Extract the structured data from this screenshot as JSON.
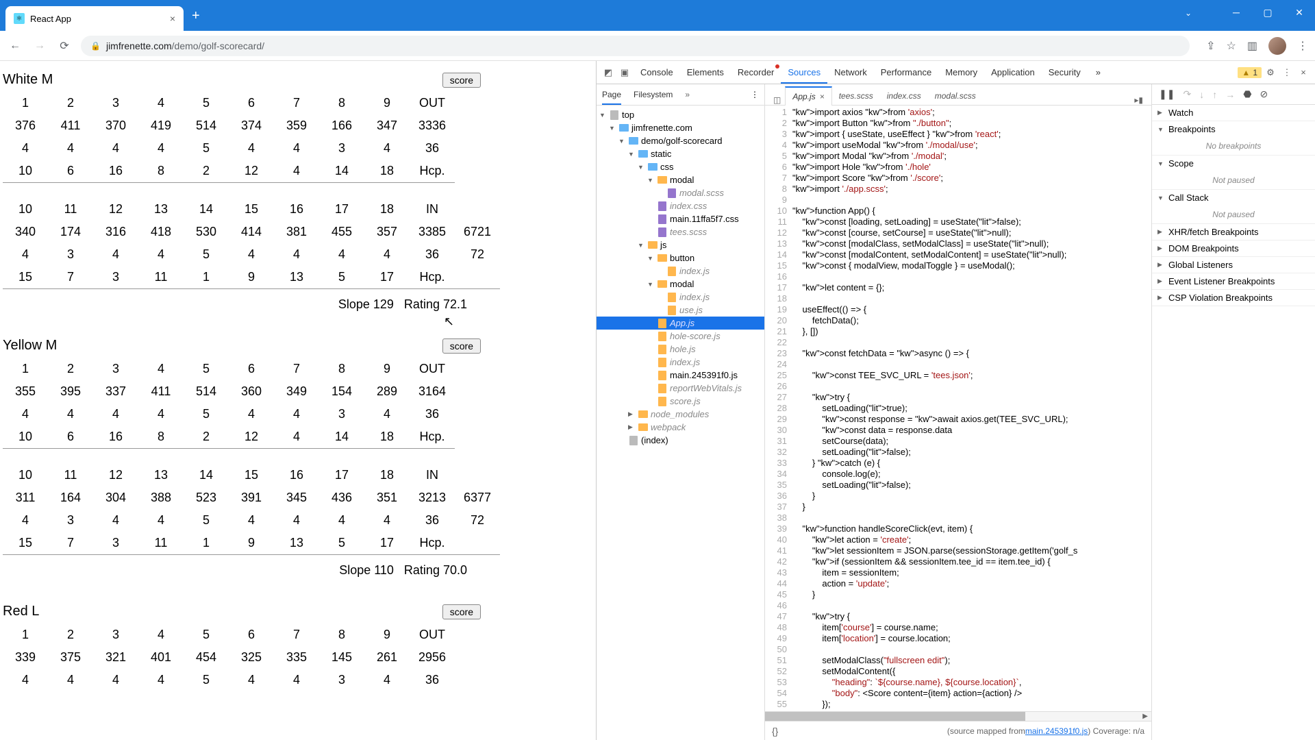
{
  "browser": {
    "tab_title": "React App",
    "url_host": "jimfrenette.com",
    "url_path": "/demo/golf-scorecard/"
  },
  "tees": [
    {
      "name": "White M",
      "score_btn": "score",
      "holes_out": [
        "1",
        "2",
        "3",
        "4",
        "5",
        "6",
        "7",
        "8",
        "9",
        "OUT"
      ],
      "yards_out": [
        "376",
        "411",
        "370",
        "419",
        "514",
        "374",
        "359",
        "166",
        "347",
        "3336"
      ],
      "par_out": [
        "4",
        "4",
        "4",
        "4",
        "5",
        "4",
        "4",
        "3",
        "4",
        "36"
      ],
      "hcp_out": [
        "10",
        "6",
        "16",
        "8",
        "2",
        "12",
        "4",
        "14",
        "18",
        "Hcp."
      ],
      "holes_in": [
        "10",
        "11",
        "12",
        "13",
        "14",
        "15",
        "16",
        "17",
        "18",
        "IN",
        ""
      ],
      "yards_in": [
        "340",
        "174",
        "316",
        "418",
        "530",
        "414",
        "381",
        "455",
        "357",
        "3385",
        "6721"
      ],
      "par_in": [
        "4",
        "3",
        "4",
        "4",
        "5",
        "4",
        "4",
        "4",
        "4",
        "36",
        "72"
      ],
      "hcp_in": [
        "15",
        "7",
        "3",
        "11",
        "1",
        "9",
        "13",
        "5",
        "17",
        "Hcp.",
        ""
      ],
      "slope": "Slope 129",
      "rating": "Rating 72.1"
    },
    {
      "name": "Yellow M",
      "score_btn": "score",
      "holes_out": [
        "1",
        "2",
        "3",
        "4",
        "5",
        "6",
        "7",
        "8",
        "9",
        "OUT"
      ],
      "yards_out": [
        "355",
        "395",
        "337",
        "411",
        "514",
        "360",
        "349",
        "154",
        "289",
        "3164"
      ],
      "par_out": [
        "4",
        "4",
        "4",
        "4",
        "5",
        "4",
        "4",
        "3",
        "4",
        "36"
      ],
      "hcp_out": [
        "10",
        "6",
        "16",
        "8",
        "2",
        "12",
        "4",
        "14",
        "18",
        "Hcp."
      ],
      "holes_in": [
        "10",
        "11",
        "12",
        "13",
        "14",
        "15",
        "16",
        "17",
        "18",
        "IN",
        ""
      ],
      "yards_in": [
        "311",
        "164",
        "304",
        "388",
        "523",
        "391",
        "345",
        "436",
        "351",
        "3213",
        "6377"
      ],
      "par_in": [
        "4",
        "3",
        "4",
        "4",
        "5",
        "4",
        "4",
        "4",
        "4",
        "36",
        "72"
      ],
      "hcp_in": [
        "15",
        "7",
        "3",
        "11",
        "1",
        "9",
        "13",
        "5",
        "17",
        "Hcp.",
        ""
      ],
      "slope": "Slope 110",
      "rating": "Rating 70.0"
    },
    {
      "name": "Red L",
      "score_btn": "score",
      "holes_out": [
        "1",
        "2",
        "3",
        "4",
        "5",
        "6",
        "7",
        "8",
        "9",
        "OUT"
      ],
      "yards_out": [
        "339",
        "375",
        "321",
        "401",
        "454",
        "325",
        "335",
        "145",
        "261",
        "2956"
      ],
      "par_out": [
        "4",
        "4",
        "4",
        "4",
        "5",
        "4",
        "4",
        "3",
        "4",
        "36"
      ]
    }
  ],
  "devtools": {
    "tabs": [
      "Console",
      "Elements",
      "Recorder",
      "Sources",
      "Network",
      "Performance",
      "Memory",
      "Application",
      "Security"
    ],
    "active_tab": "Sources",
    "issue_count": "1",
    "src_subtabs": [
      "Page",
      "Filesystem"
    ],
    "editor_tabs": [
      "App.js",
      "tees.scss",
      "index.css",
      "modal.scss"
    ],
    "active_editor_tab": "App.js",
    "tree": {
      "top": "top",
      "domain": "jimfrenette.com",
      "demo": "demo/golf-scorecard",
      "static": "static",
      "css": "css",
      "modal_css": "modal",
      "modal_scss": "modal.scss",
      "index_css": "index.css",
      "main_css": "main.11ffa5f7.css",
      "tees_scss": "tees.scss",
      "js": "js",
      "button": "button",
      "button_index": "index.js",
      "modal_js": "modal",
      "modal_index": "index.js",
      "use_js": "use.js",
      "app_js": "App.js",
      "hole_score": "hole-score.js",
      "hole_js": "hole.js",
      "index_js": "index.js",
      "main_js": "main.245391f0.js",
      "rwv": "reportWebVitals.js",
      "score_js": "score.js",
      "node_modules": "node_modules",
      "webpack": "webpack",
      "index_html": "(index)"
    },
    "status_prefix": "(source mapped from ",
    "status_link": "main.245391f0.js",
    "status_suffix": ")  Coverage: n/a",
    "debug_sections": [
      {
        "title": "Watch",
        "open": false
      },
      {
        "title": "Breakpoints",
        "open": true,
        "body": "No breakpoints"
      },
      {
        "title": "Scope",
        "open": true,
        "body": "Not paused"
      },
      {
        "title": "Call Stack",
        "open": true,
        "body": "Not paused"
      },
      {
        "title": "XHR/fetch Breakpoints",
        "open": false
      },
      {
        "title": "DOM Breakpoints",
        "open": false
      },
      {
        "title": "Global Listeners",
        "open": false
      },
      {
        "title": "Event Listener Breakpoints",
        "open": false
      },
      {
        "title": "CSP Violation Breakpoints",
        "open": false
      }
    ]
  },
  "code_lines": [
    "import axios from 'axios';",
    "import Button from \"./button\";",
    "import { useState, useEffect } from 'react';",
    "import useModal from './modal/use';",
    "import Modal from './modal';",
    "import Hole from './hole'",
    "import Score from './score';",
    "import './app.scss';",
    "",
    "function App() {",
    "    const [loading, setLoading] = useState(false);",
    "    const [course, setCourse] = useState(null);",
    "    const [modalClass, setModalClass] = useState(null);",
    "    const [modalContent, setModalContent] = useState(null);",
    "    const { modalView, modalToggle } = useModal();",
    "",
    "    let content = {};",
    "",
    "    useEffect(() => {",
    "        fetchData();",
    "    }, [])",
    "",
    "    const fetchData = async () => {",
    "",
    "        const TEE_SVC_URL = 'tees.json';",
    "",
    "        try {",
    "            setLoading(true);",
    "            const response = await axios.get(TEE_SVC_URL);",
    "            const data = response.data",
    "            setCourse(data);",
    "            setLoading(false);",
    "        } catch (e) {",
    "            console.log(e);",
    "            setLoading(false);",
    "        }",
    "    }",
    "",
    "    function handleScoreClick(evt, item) {",
    "        let action = 'create';",
    "        let sessionItem = JSON.parse(sessionStorage.getItem('golf_s",
    "        if (sessionItem && sessionItem.tee_id == item.tee_id) {",
    "            item = sessionItem;",
    "            action = 'update';",
    "        }",
    "",
    "        try {",
    "            item['course'] = course.name;",
    "            item['location'] = course.location;",
    "",
    "            setModalClass(\"fullscreen edit\");",
    "            setModalContent({",
    "                \"heading\": `${course.name}, ${course.location}`,",
    "                \"body\": <Score content={item} action={action} />",
    "            });"
  ]
}
